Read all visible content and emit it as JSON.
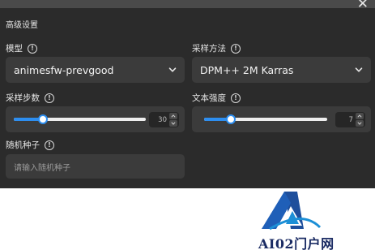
{
  "dialog": {
    "section_title": "高级设置",
    "close_glyph": "✕"
  },
  "model": {
    "label": "模型",
    "selected": "animesfw-prevgood"
  },
  "sampler": {
    "label": "采样方法",
    "selected": "DPM++ 2M Karras"
  },
  "steps": {
    "label": "采样步数",
    "value": "30",
    "fill_fraction": 0.22
  },
  "text_strength": {
    "label": "文本强度",
    "value": "7",
    "fill_fraction": 0.22
  },
  "seed": {
    "label": "随机种子",
    "placeholder": "请输入随机种子"
  },
  "watermark": {
    "text": "AI02门户网"
  },
  "colors": {
    "panel_bg": "#2b2b2b",
    "field_bg": "#3b3b3b",
    "accent": "#2d8ef0"
  },
  "icons": [
    "close-icon",
    "info-icon",
    "chevron-down-icon",
    "chevron-up-icon"
  ]
}
